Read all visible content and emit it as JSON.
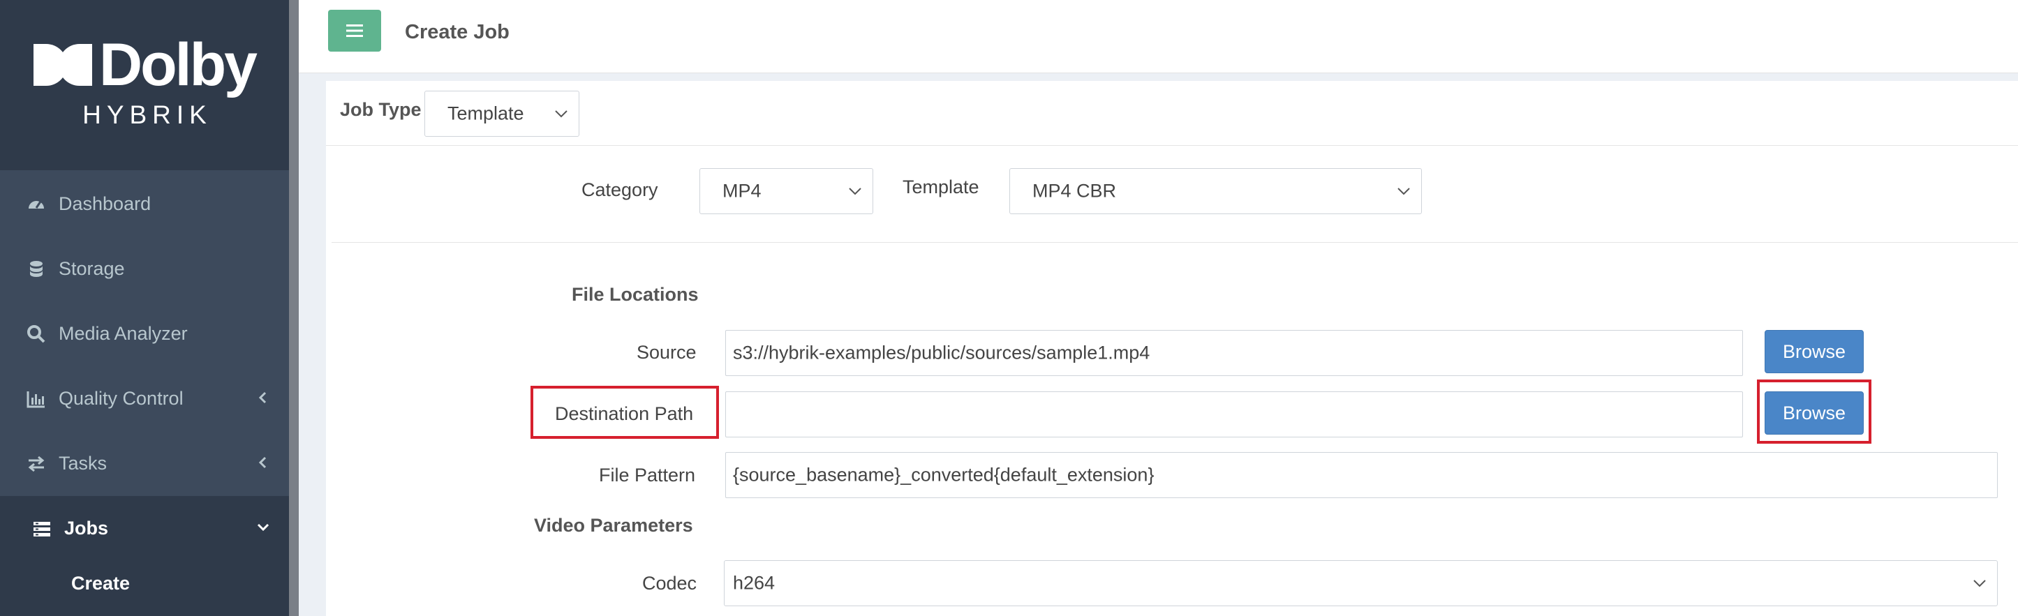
{
  "logo": {
    "word": "Dolby",
    "sub": "HYBRIK"
  },
  "sidebar": {
    "items": [
      {
        "label": "Dashboard",
        "icon": "dashboard-icon"
      },
      {
        "label": "Storage",
        "icon": "database-icon"
      },
      {
        "label": "Media Analyzer",
        "icon": "search-icon"
      },
      {
        "label": "Quality Control",
        "icon": "bar-chart-icon"
      },
      {
        "label": "Tasks",
        "icon": "exchange-icon"
      },
      {
        "label": "Jobs",
        "icon": "jobs-icon"
      }
    ],
    "sub_item": "Create"
  },
  "header": {
    "title": "Create Job"
  },
  "job_type": {
    "label": "Job Type",
    "value": "Template"
  },
  "category": {
    "label": "Category",
    "value": "MP4"
  },
  "template": {
    "label": "Template",
    "value": "MP4 CBR"
  },
  "file_locations": {
    "heading": "File Locations",
    "source_label": "Source",
    "source_value": "s3://hybrik-examples/public/sources/sample1.mp4",
    "destination_label": "Destination Path",
    "destination_value": "",
    "pattern_label": "File Pattern",
    "pattern_value": "{source_basename}_converted{default_extension}",
    "browse_label": "Browse"
  },
  "video": {
    "heading": "Video Parameters",
    "codec_label": "Codec",
    "codec_value": "h264"
  },
  "colors": {
    "accent": "#5fb48f",
    "primary": "#4a86c8",
    "highlight": "#d6202e",
    "sidebar": "#3d4a5c"
  }
}
